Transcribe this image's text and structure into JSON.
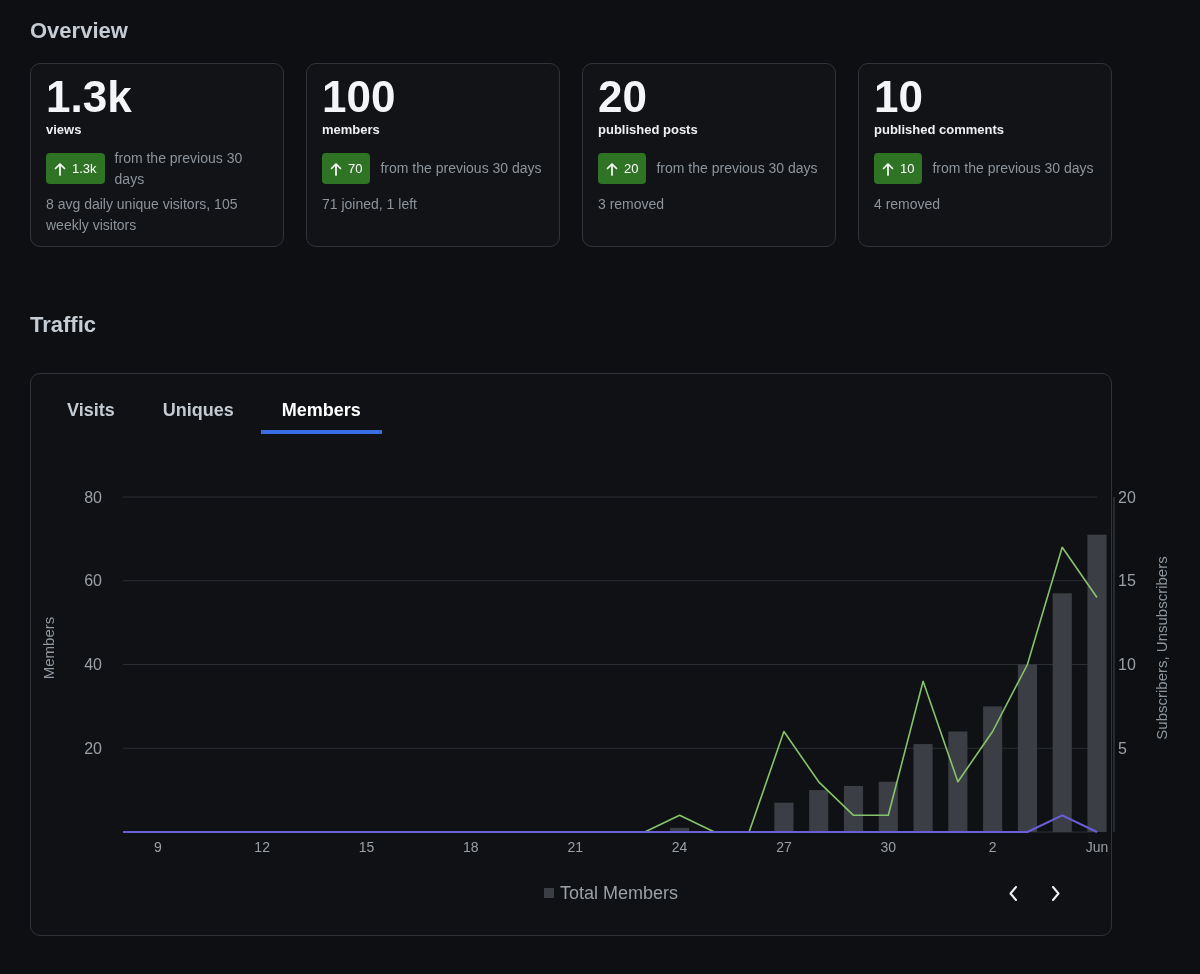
{
  "overview": {
    "title": "Overview",
    "cards": [
      {
        "value": "1.3k",
        "label": "views",
        "increase": true,
        "change": "1.3k",
        "comparison": "from the previous 30 days",
        "detail": "8 avg daily unique visitors, 105 weekly visitors"
      },
      {
        "value": "100",
        "label": "members",
        "increase": true,
        "change": "70",
        "comparison": "from the previous 30 days",
        "detail": "71 joined, 1 left"
      },
      {
        "value": "20",
        "label": "published posts",
        "increase": true,
        "change": "20",
        "comparison": "from the previous 30 days",
        "detail": "3 removed"
      },
      {
        "value": "10",
        "label": "published comments",
        "increase": true,
        "change": "10",
        "comparison": "from the previous 30 days",
        "detail": "4 removed"
      }
    ]
  },
  "traffic": {
    "title": "Traffic",
    "tabs": [
      {
        "label": "Visits",
        "selected": false
      },
      {
        "label": "Uniques",
        "selected": false
      },
      {
        "label": "Members",
        "selected": true
      }
    ],
    "chart_data": {
      "type": "bar",
      "grid": true,
      "ylabel": "Members",
      "y2label": "Subscribers, Unsubscribers",
      "x": [
        "--05-08",
        "--05-09",
        "--05-10",
        "--05-11",
        "--05-12",
        "--05-13",
        "--05-14",
        "--05-15",
        "--05-16",
        "--05-17",
        "--05-18",
        "--05-19",
        "--05-20",
        "--05-21",
        "--05-22",
        "--05-23",
        "--05-24",
        "--05-25",
        "--05-26",
        "--05-27",
        "--05-28",
        "--05-29",
        "--05-30",
        "--05-31",
        "--06-01",
        "--06-02",
        "--06-03",
        "--06-04",
        "--06-05"
      ],
      "xlim": [
        "--05-08",
        "--06-05"
      ],
      "xticks": [
        {
          "value": "--05-09",
          "label": "9"
        },
        {
          "value": "--05-12",
          "label": "12"
        },
        {
          "value": "--05-15",
          "label": "15"
        },
        {
          "value": "--05-18",
          "label": "18"
        },
        {
          "value": "--05-21",
          "label": "21"
        },
        {
          "value": "--05-24",
          "label": "24"
        },
        {
          "value": "--05-27",
          "label": "27"
        },
        {
          "value": "--05-30",
          "label": "30"
        },
        {
          "value": "--06-02",
          "label": "2"
        },
        {
          "value": "--06-05",
          "label": "Jun"
        }
      ],
      "ylim": [
        0,
        80
      ],
      "yticks": [
        {
          "value": 20,
          "label": "20"
        },
        {
          "value": 40,
          "label": "40"
        },
        {
          "value": 60,
          "label": "60"
        },
        {
          "value": 80,
          "label": "80"
        }
      ],
      "y2lim": [
        0,
        20
      ],
      "y2ticks": [
        {
          "value": 5,
          "label": "5"
        },
        {
          "value": 10,
          "label": "10"
        },
        {
          "value": 15,
          "label": "15"
        },
        {
          "value": 20,
          "label": "20"
        }
      ],
      "series": [
        {
          "name": "Total Members",
          "color": "#3b3f45",
          "values": [
            0,
            0,
            0,
            0,
            0,
            0,
            0,
            0,
            0,
            0,
            0,
            0,
            0,
            0,
            0,
            0,
            1,
            0,
            0,
            7,
            10,
            11,
            12,
            21,
            24,
            30,
            40,
            57,
            71
          ]
        },
        {
          "type": "line",
          "axis": "y2",
          "color": "#86c46c",
          "values": [
            null,
            null,
            null,
            null,
            null,
            null,
            null,
            null,
            null,
            null,
            null,
            null,
            null,
            null,
            null,
            0,
            1,
            0,
            0,
            6,
            3,
            1,
            1,
            9,
            3,
            6,
            10,
            17,
            14
          ]
        },
        {
          "type": "line",
          "axis": "y2",
          "color": "#6a5fd8",
          "values": [
            0,
            0,
            0,
            0,
            0,
            0,
            0,
            0,
            0,
            0,
            0,
            0,
            0,
            0,
            0,
            0,
            0,
            0,
            0,
            0,
            0,
            0,
            0,
            0,
            0,
            0,
            0,
            1,
            0
          ]
        }
      ]
    }
  }
}
